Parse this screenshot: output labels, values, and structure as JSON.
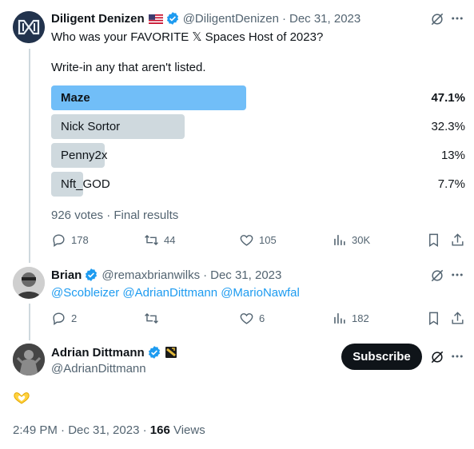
{
  "tweet1": {
    "name": "Diligent Denizen",
    "handle": "@DiligentDenizen",
    "sep": "·",
    "date": "Dec 31, 2023",
    "text_line1": "Who was your FAVORITE 𝕏 Spaces Host of 2023?",
    "text_line2": "Write-in any that aren't listed.",
    "poll": {
      "options": [
        {
          "label": "Maze",
          "pct": "47.1%",
          "value": 47.1,
          "winner": true
        },
        {
          "label": "Nick Sortor",
          "pct": "32.3%",
          "value": 32.3,
          "winner": false
        },
        {
          "label": "Penny2x",
          "pct": "13%",
          "value": 13,
          "winner": false
        },
        {
          "label": "Nft_GOD",
          "pct": "7.7%",
          "value": 7.7,
          "winner": false
        }
      ],
      "summary": "926 votes · Final results"
    },
    "actions": {
      "replies": "178",
      "reposts": "44",
      "likes": "105",
      "views": "30K"
    }
  },
  "tweet2": {
    "name": "Brian",
    "handle": "@remaxbrianwilks",
    "sep": "·",
    "date": "Dec 31, 2023",
    "mentions": "@Scobleizer @AdrianDittmann @MarioNawfal",
    "actions": {
      "replies": "2",
      "reposts": "",
      "likes": "6",
      "views": "182"
    }
  },
  "tweet3": {
    "name": "Adrian Dittmann",
    "handle": "@AdrianDittmann",
    "subscribe_label": "Subscribe",
    "emoji": "🫶",
    "footer": {
      "time": "2:49 PM · Dec 31, 2023 · ",
      "views_count": "166",
      "views_label": " Views"
    }
  },
  "colors": {
    "accent": "#1d9bf0",
    "winner_bar": "#71bef8",
    "poll_bar": "#cfd9de",
    "text_secondary": "#536471"
  }
}
